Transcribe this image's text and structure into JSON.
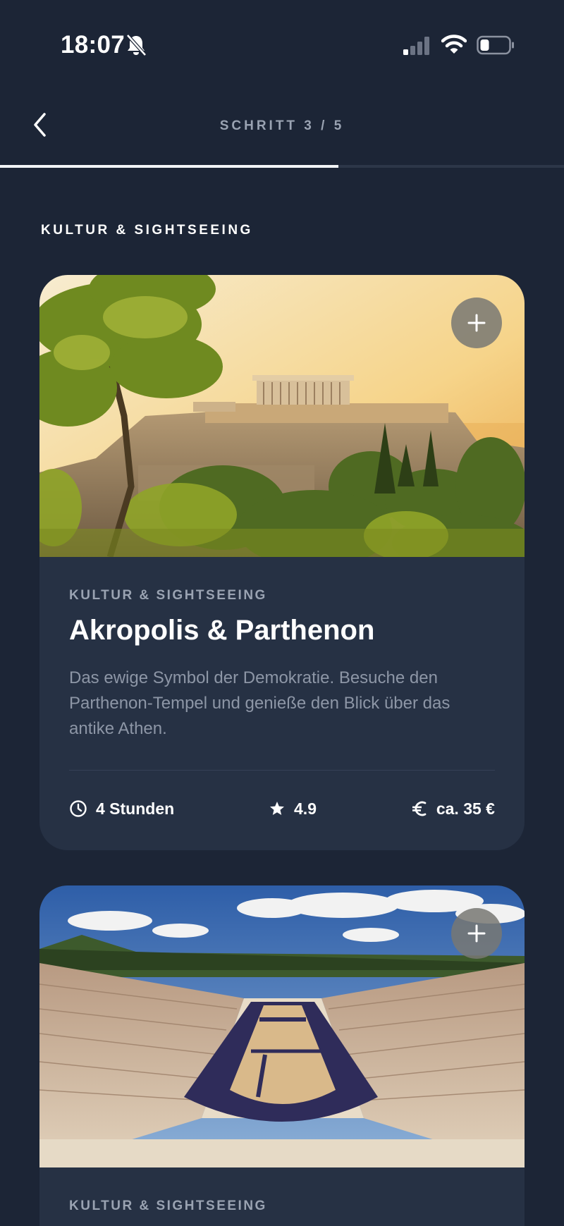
{
  "status_bar": {
    "time": "18:07",
    "icons": [
      "bell-slash-icon",
      "signal-icon",
      "wifi-icon",
      "battery-icon"
    ],
    "battery_level": 0.25
  },
  "header": {
    "step_label": "SCHRITT 3 / 5",
    "progress": 0.6,
    "icons": [
      "chevron-left-icon"
    ]
  },
  "section": {
    "title": "KULTUR & SIGHTSEEING"
  },
  "cards": [
    {
      "category": "KULTUR & SIGHTSEEING",
      "title": "Akropolis & Parthenon",
      "description": "Das ewige Symbol der Demokratie. Besuche den Parthenon-Tempel und genieße den Blick über das antike Athen.",
      "duration": "4 Stunden",
      "rating": "4.9",
      "price": "ca. 35 €",
      "image": "acropolis-photo",
      "icons": [
        "plus-icon",
        "clock-icon",
        "star-icon",
        "euro-icon"
      ]
    },
    {
      "category": "KULTUR & SIGHTSEEING",
      "image": "panathenaic-stadium-photo",
      "icons": [
        "plus-icon"
      ]
    }
  ],
  "colors": {
    "background": "#1c2536",
    "card": "#263144",
    "muted_text": "#9aa3b2",
    "accent": "#ffffff"
  }
}
